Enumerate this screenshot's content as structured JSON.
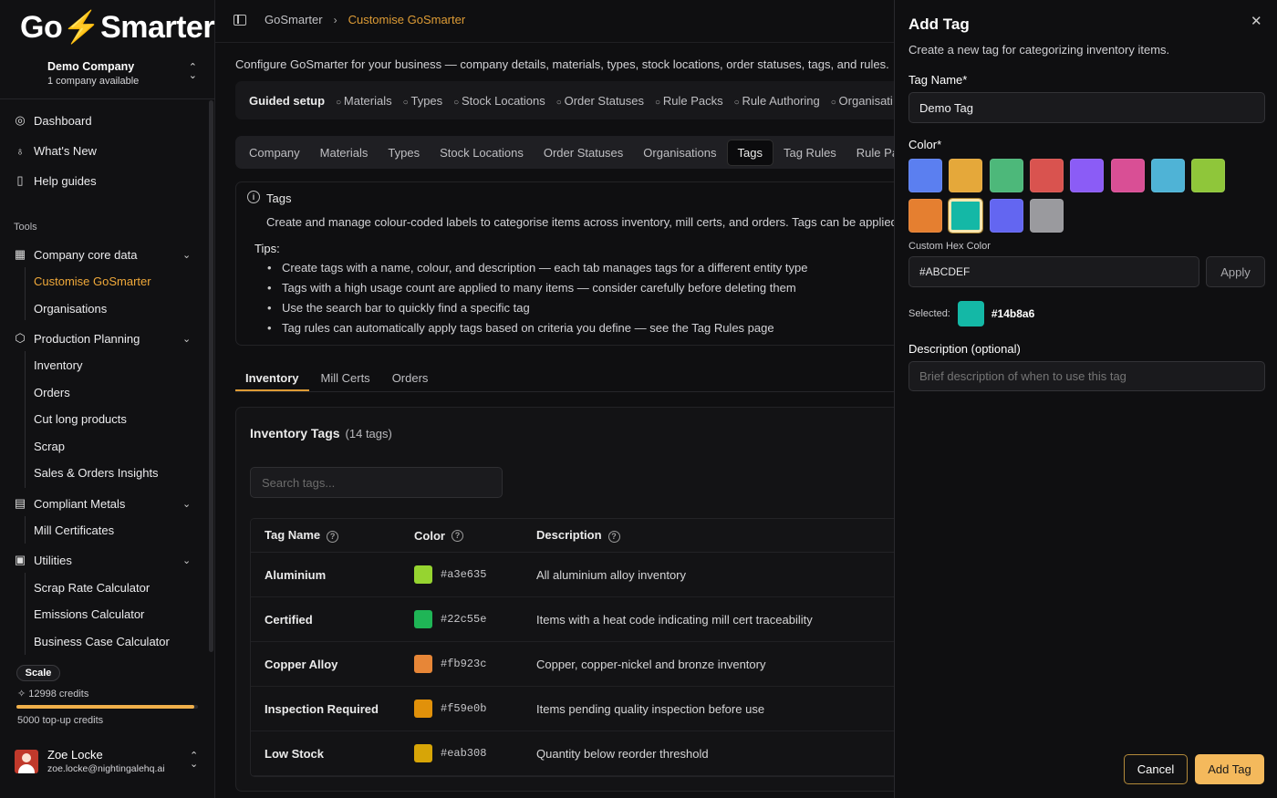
{
  "app": {
    "logo_text": "GoSmarter",
    "company_name": "Demo Company",
    "company_sub": "1 company available"
  },
  "sidebar": {
    "top_items": [
      {
        "label": "Dashboard",
        "icon": "dashboard-icon"
      },
      {
        "label": "What's New",
        "icon": "lightbulb-icon"
      },
      {
        "label": "Help guides",
        "icon": "book-icon"
      }
    ],
    "section_label": "Tools",
    "groups": [
      {
        "label": "Company core data",
        "icon": "building-icon",
        "items": [
          "Customise GoSmarter",
          "Organisations"
        ]
      },
      {
        "label": "Production Planning",
        "icon": "cube-icon",
        "items": [
          "Inventory",
          "Orders",
          "Cut long products",
          "Scrap",
          "Sales & Orders Insights"
        ]
      },
      {
        "label": "Compliant Metals",
        "icon": "document-icon",
        "items": [
          "Mill Certificates"
        ]
      },
      {
        "label": "Utilities",
        "icon": "calculator-icon",
        "items": [
          "Scrap Rate Calculator",
          "Emissions Calculator",
          "Business Case Calculator"
        ]
      }
    ],
    "active_item": "Customise GoSmarter",
    "plan": "Scale",
    "credits": "12998 credits",
    "credits_fraction": 0.98,
    "topup": "5000 top-up credits",
    "user_name": "Zoe Locke",
    "user_email": "zoe.locke@nightingalehq.ai"
  },
  "header": {
    "crumb_root": "GoSmarter",
    "crumb_current": "Customise GoSmarter"
  },
  "main": {
    "intro": "Configure GoSmarter for your business — company details, materials, types, stock locations, order statuses, tags, and rules.",
    "guided_title": "Guided setup",
    "guided_steps": [
      "Materials",
      "Types",
      "Stock Locations",
      "Order Statuses",
      "Rule Packs",
      "Rule Authoring",
      "Organisati"
    ],
    "tabs": [
      "Company",
      "Materials",
      "Types",
      "Stock Locations",
      "Order Statuses",
      "Organisations",
      "Tags",
      "Tag Rules",
      "Rule Pa"
    ],
    "active_tab": "Tags",
    "info_title": "Tags",
    "info_desc": "Create and manage colour-coded labels to categorise items across inventory, mill certs, and orders. Tags can be applied",
    "tips_title": "Tips:",
    "tips": [
      "Create tags with a name, colour, and description — each tab manages tags for a different entity type",
      "Tags with a high usage count are applied to many items — consider carefully before deleting them",
      "Use the search bar to quickly find a specific tag",
      "Tag rules can automatically apply tags based on criteria you define — see the Tag Rules page"
    ],
    "subtabs": [
      "Inventory",
      "Mill Certs",
      "Orders"
    ],
    "active_subtab": "Inventory",
    "card_title": "Inventory Tags",
    "card_count": "(14 tags)",
    "search_placeholder": "Search tags...",
    "table": {
      "headers": [
        "Tag Name",
        "Color",
        "Description"
      ],
      "rows": [
        {
          "name": "Aluminium",
          "color": "#a3e635",
          "description": "All aluminium alloy inventory"
        },
        {
          "name": "Certified",
          "color": "#22c55e",
          "description": "Items with a heat code indicating mill cert traceability"
        },
        {
          "name": "Copper Alloy",
          "color": "#fb923c",
          "description": "Copper, copper-nickel and bronze inventory"
        },
        {
          "name": "Inspection Required",
          "color": "#f59e0b",
          "description": "Items pending quality inspection before use"
        },
        {
          "name": "Low Stock",
          "color": "#eab308",
          "description": "Quantity below reorder threshold"
        }
      ]
    }
  },
  "drawer": {
    "title": "Add Tag",
    "subtitle": "Create a new tag for categorizing inventory items.",
    "name_label": "Tag Name*",
    "name_value": "Demo Tag",
    "color_label": "Color*",
    "palette": [
      "#5b7ff0",
      "#e5a83a",
      "#4db87a",
      "#d9534f",
      "#8b5cf6",
      "#d94f95",
      "#4fb3d6",
      "#8fc63a",
      "#e57f30",
      "#14b8a6",
      "#6366f1",
      "#9a9a9e"
    ],
    "selected_index": 9,
    "custom_label": "Custom Hex Color",
    "custom_value": "#ABCDEF",
    "apply_label": "Apply",
    "selected_label": "Selected:",
    "selected_value": "#14b8a6",
    "desc_label": "Description (optional)",
    "desc_placeholder": "Brief description of when to use this tag",
    "cancel_label": "Cancel",
    "add_label": "Add Tag"
  }
}
